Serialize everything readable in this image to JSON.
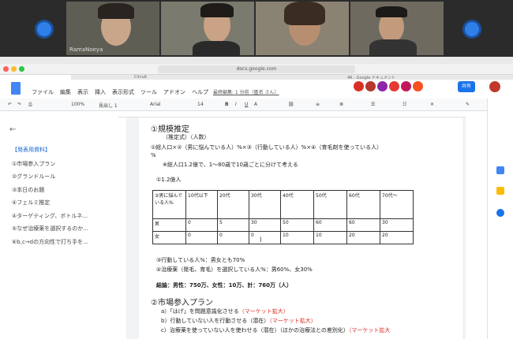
{
  "video": {
    "tiles": [
      {
        "name": "RamaNoeya"
      },
      {
        "name": ""
      },
      {
        "name": ""
      },
      {
        "name": ""
      }
    ]
  },
  "browser": {
    "url": "docs.google.com",
    "tabs": [
      "Circuit",
      "4R - Google ドキュメント"
    ]
  },
  "docs": {
    "menu": [
      "ファイル",
      "編集",
      "表示",
      "挿入",
      "表示形式",
      "ツール",
      "アドオン",
      "ヘルプ"
    ],
    "last_edit": "最終編集: 1 分前（匿名 さん）",
    "share_label": "共有",
    "toolbar": {
      "zoom": "100%",
      "style": "見出し 1",
      "font": "Arial",
      "size": "14"
    }
  },
  "outline": {
    "items": [
      "【発表用資料】",
      "①市場参入プラン",
      "②グランドルール",
      "③本日のお題",
      "④フェルミ推定",
      "④ターゲティング、ボトルネ...",
      "⑤なぜ治療薬を選択するのか...",
      "⑥b,c→dの方向性で打ち手を..."
    ]
  },
  "page": {
    "h_market": "①規模推定",
    "sub": "（推定式）（人数）",
    "formula": "①総人口×②（男に悩んでいる人）%×③（行動している人）%×④（育毛剤を使っている人）",
    "formula_cont": "%",
    "note1": "※総人口1.2億で、1〜80歳で10歳ごとに分けて考える",
    "pop": "①1.2億人",
    "table": {
      "header": [
        "②男に悩んでいる人%",
        "10代以下",
        "20代",
        "30代",
        "40代",
        "50代",
        "60代",
        "70代〜"
      ],
      "rows": [
        [
          "男",
          "0",
          "5",
          "30",
          "50",
          "60",
          "60",
          "30"
        ],
        [
          "女",
          "0",
          "0",
          "0",
          "10",
          "10",
          "20",
          "20"
        ]
      ]
    },
    "line3": "③行動している人%：男女とも70%",
    "line4": "④治療薬（発毛、育毛）を選択している人%：男60%、女30%",
    "result": "結論：男性：750万、女性：10万、計：760万（人）",
    "h_entry": "②市場参入プラン",
    "a": "a）「はげ」を問題意識化させる",
    "a_tag": "（マーケット拡大）",
    "b": "b）行動していない人を行動させる（潜在）",
    "b_tag": "（マーケット拡大）",
    "c": "c）治療薬を使っていない人を使わせる（潜在）（ほかの治療法との差別化）",
    "c_tag": "（マーケット拡大"
  },
  "colors": {
    "accent": "#1a73e8",
    "red": "#d93025"
  }
}
